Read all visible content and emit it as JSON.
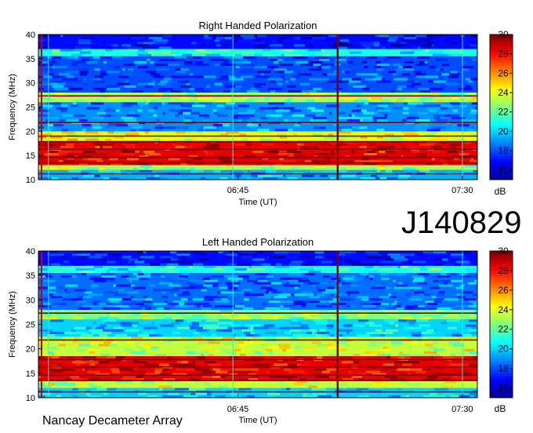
{
  "observation_id": "J140829",
  "footer": "Nancay Decameter Array",
  "chart_data": [
    {
      "type": "heatmap",
      "title": "Right Handed Polarization",
      "xlabel": "Time (UT)",
      "ylabel": "Frequency (MHz)",
      "x_range": [
        "06:05",
        "07:33"
      ],
      "xticks": [
        "06:45",
        "07:30"
      ],
      "ylim": [
        10,
        40
      ],
      "yticks": [
        10,
        15,
        20,
        25,
        30,
        35,
        40
      ],
      "colorbar": {
        "label": "dB",
        "range": [
          15,
          30
        ],
        "ticks": [
          16,
          18,
          20,
          22,
          24,
          26,
          28,
          30
        ]
      },
      "colormap": [
        "#00008f",
        "#0000ff",
        "#0080ff",
        "#00ffff",
        "#80ff80",
        "#ffff00",
        "#ff8000",
        "#ff0000",
        "#800000"
      ],
      "bands": [
        {
          "f0": 10.0,
          "f1": 12.0,
          "level": 19.5
        },
        {
          "f0": 12.0,
          "f1": 13.0,
          "level": 23.0
        },
        {
          "f0": 13.0,
          "f1": 18.0,
          "level": 28.5
        },
        {
          "f0": 18.0,
          "f1": 20.0,
          "level": 24.0
        },
        {
          "f0": 20.0,
          "f1": 26.0,
          "level": 19.0
        },
        {
          "f0": 26.0,
          "f1": 28.0,
          "level": 23.0
        },
        {
          "f0": 28.0,
          "f1": 35.5,
          "level": 18.0
        },
        {
          "f0": 35.5,
          "f1": 37.0,
          "level": 21.0
        },
        {
          "f0": 37.0,
          "f1": 40.0,
          "level": 17.0
        }
      ],
      "lines_mhz": [
        11.2,
        13.5,
        14.6,
        16.3,
        17.8,
        19.0,
        21.8,
        27.3
      ],
      "vertical_lines": [
        "06:07",
        "06:44",
        "07:05",
        "07:30"
      ]
    },
    {
      "type": "heatmap",
      "title": "Left Handed Polarization",
      "xlabel": "Time (UT)",
      "ylabel": "Frequency (MHz)",
      "x_range": [
        "06:05",
        "07:33"
      ],
      "xticks": [
        "06:45",
        "07:30"
      ],
      "ylim": [
        10,
        40
      ],
      "yticks": [
        10,
        15,
        20,
        25,
        30,
        35,
        40
      ],
      "colorbar": {
        "label": "dB",
        "range": [
          15,
          30
        ],
        "ticks": [
          16,
          18,
          20,
          22,
          24,
          26,
          28,
          30
        ]
      },
      "colormap": [
        "#00008f",
        "#0000ff",
        "#0080ff",
        "#00ffff",
        "#80ff80",
        "#ffff00",
        "#ff8000",
        "#ff0000",
        "#800000"
      ],
      "bands": [
        {
          "f0": 10.0,
          "f1": 12.0,
          "level": 20.0
        },
        {
          "f0": 12.0,
          "f1": 13.5,
          "level": 23.5
        },
        {
          "f0": 13.5,
          "f1": 18.5,
          "level": 28.5
        },
        {
          "f0": 18.5,
          "f1": 22.5,
          "level": 23.5
        },
        {
          "f0": 22.5,
          "f1": 26.0,
          "level": 20.0
        },
        {
          "f0": 26.0,
          "f1": 28.0,
          "level": 22.5
        },
        {
          "f0": 28.0,
          "f1": 35.5,
          "level": 18.5
        },
        {
          "f0": 35.5,
          "f1": 37.0,
          "level": 21.0
        },
        {
          "f0": 37.0,
          "f1": 40.0,
          "level": 17.0
        }
      ],
      "lines_mhz": [
        11.2,
        13.5,
        14.6,
        16.3,
        17.8,
        21.8,
        27.3
      ],
      "vertical_lines": [
        "06:07",
        "06:44",
        "07:05",
        "07:30"
      ]
    }
  ]
}
